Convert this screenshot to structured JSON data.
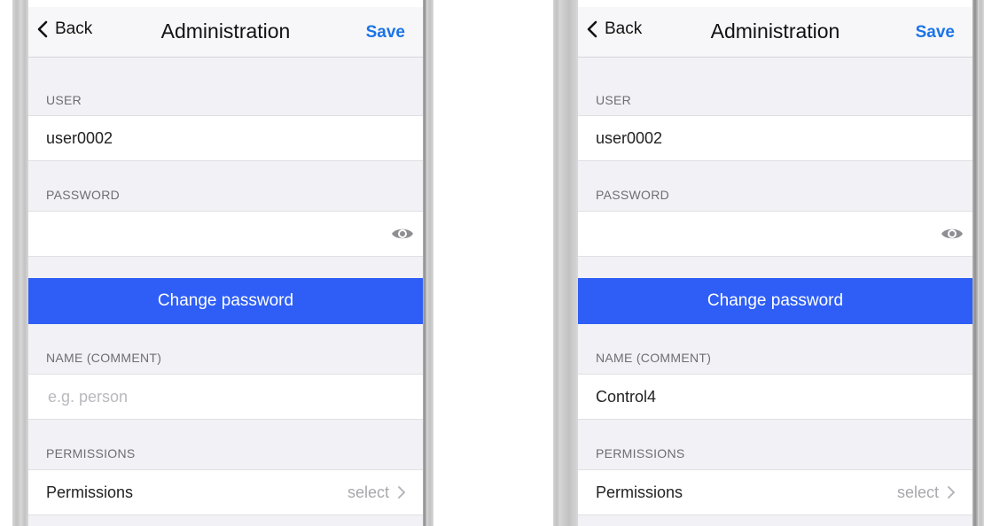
{
  "screens": [
    {
      "back_label": "Back",
      "title": "Administration",
      "save_label": "Save",
      "user_label": "USER",
      "user_value": "user0002",
      "password_label": "PASSWORD",
      "password_value": "",
      "change_password_label": "Change password",
      "name_label": "NAME (COMMENT)",
      "name_value": "",
      "name_placeholder": "e.g. person",
      "permissions_label": "PERMISSIONS",
      "permissions_row_label": "Permissions",
      "permissions_value": "select"
    },
    {
      "back_label": "Back",
      "title": "Administration",
      "save_label": "Save",
      "user_label": "USER",
      "user_value": "user0002",
      "password_label": "PASSWORD",
      "password_value": "",
      "change_password_label": "Change password",
      "name_label": "NAME (COMMENT)",
      "name_value": "Control4",
      "name_placeholder": "e.g. person",
      "permissions_label": "PERMISSIONS",
      "permissions_row_label": "Permissions",
      "permissions_value": "select"
    }
  ],
  "colors": {
    "accent": "#1a73e8",
    "button": "#2e5ef5",
    "background": "#f2f2f6"
  },
  "icons": [
    "chevron-left-icon",
    "eye-icon",
    "chevron-right-icon"
  ]
}
